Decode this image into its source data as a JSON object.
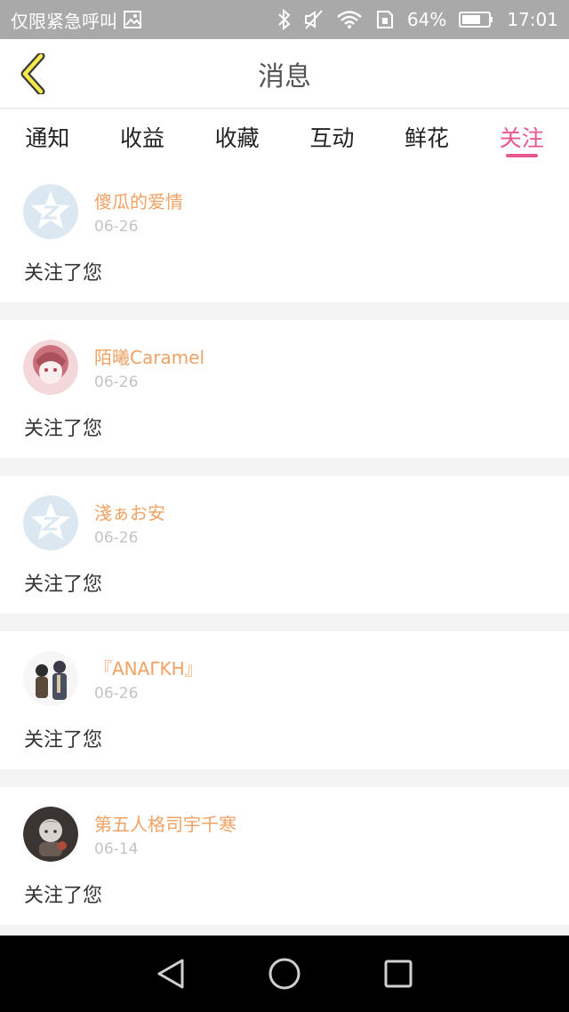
{
  "status_bar": {
    "carrier": "仅限紧急呼叫",
    "battery": "64%",
    "time": "17:01"
  },
  "header": {
    "title": "消息"
  },
  "tabs": [
    {
      "label": "通知"
    },
    {
      "label": "收益"
    },
    {
      "label": "收藏"
    },
    {
      "label": "互动"
    },
    {
      "label": "鲜花"
    },
    {
      "label": "关注"
    }
  ],
  "active_tab": "关注",
  "colors": {
    "accent": "#e8578f",
    "username": "#f0a264",
    "date": "#c4c4c4"
  },
  "items": [
    {
      "username": "傻瓜的爱情",
      "date": "06-26",
      "action": "关注了您",
      "avatar": "default-avatar-icon"
    },
    {
      "username": "陌曦Caramel",
      "date": "06-26",
      "action": "关注了您",
      "avatar": "user-avatar"
    },
    {
      "username": "淺ぁお安",
      "date": "06-26",
      "action": "关注了您",
      "avatar": "default-avatar-icon"
    },
    {
      "username": "『ΑΝΑΓΚΗ』",
      "date": "06-26",
      "action": "关注了您",
      "avatar": "user-avatar"
    },
    {
      "username": "第五人格司宇千寒",
      "date": "06-14",
      "action": "关注了您",
      "avatar": "user-avatar"
    }
  ]
}
